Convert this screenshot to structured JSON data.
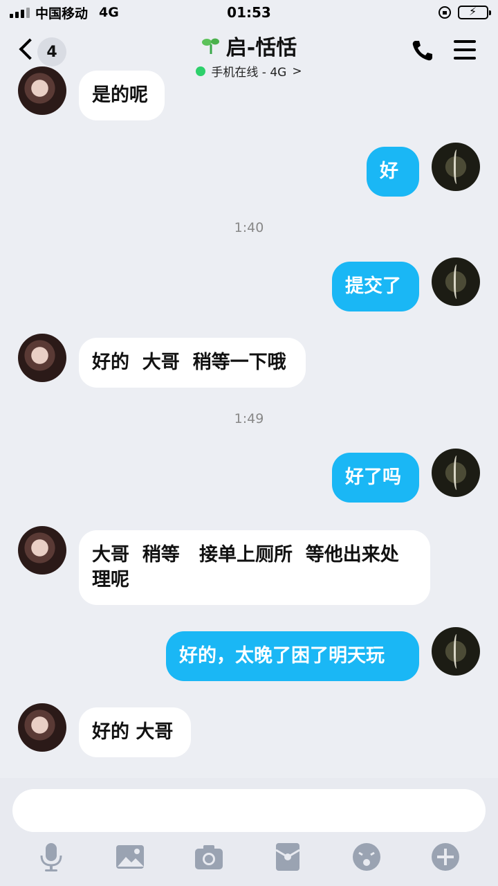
{
  "status_bar": {
    "carrier": "中国移动",
    "network": "4G",
    "time": "01:53"
  },
  "header": {
    "unread_count": "4",
    "contact_name": "启-恬恬",
    "status": "手机在线 - 4G",
    "chevron": ">"
  },
  "messages": [
    {
      "from": "her",
      "text": "是的呢"
    },
    {
      "from": "me",
      "text": "好"
    },
    {
      "timestamp": "1:40"
    },
    {
      "from": "me",
      "text": "提交了"
    },
    {
      "from": "her",
      "text": "好的  大哥  稍等一下哦"
    },
    {
      "timestamp": "1:49"
    },
    {
      "from": "me",
      "text": "好了吗"
    },
    {
      "from": "her",
      "text": "大哥  稍等   接单上厕所  等他出来处理呢"
    },
    {
      "from": "me",
      "text": "好的，太晚了困了明天玩"
    },
    {
      "from": "her",
      "text": "好的 大哥"
    }
  ],
  "toolbar": {
    "icons": [
      "microphone-icon",
      "image-icon",
      "camera-icon",
      "red-packet-icon",
      "emoji-icon",
      "plus-icon"
    ]
  },
  "colors": {
    "outgoing_bubble": "#1ab7f5",
    "incoming_bubble": "#ffffff",
    "background": "#eceef3",
    "online": "#2ed06b"
  }
}
